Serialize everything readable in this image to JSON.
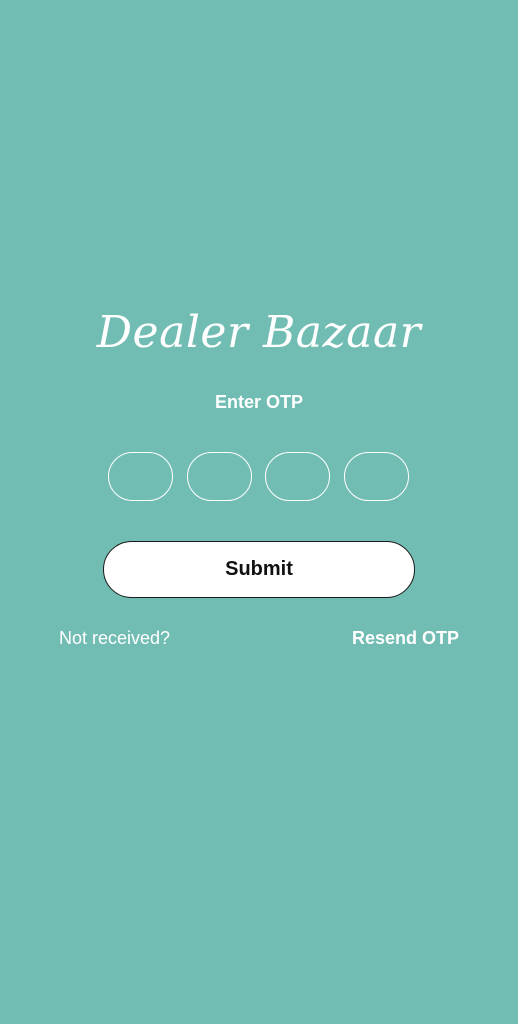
{
  "app": {
    "brand_title": "Dealer Bazaar"
  },
  "otp": {
    "prompt": "Enter OTP",
    "digits": [
      "",
      "",
      "",
      ""
    ]
  },
  "actions": {
    "submit_label": "Submit",
    "not_received_label": "Not received?",
    "resend_label": "Resend OTP"
  },
  "colors": {
    "background": "#72bdb3",
    "foreground": "#ffffff",
    "button_background": "#ffffff",
    "button_text": "#111111"
  }
}
